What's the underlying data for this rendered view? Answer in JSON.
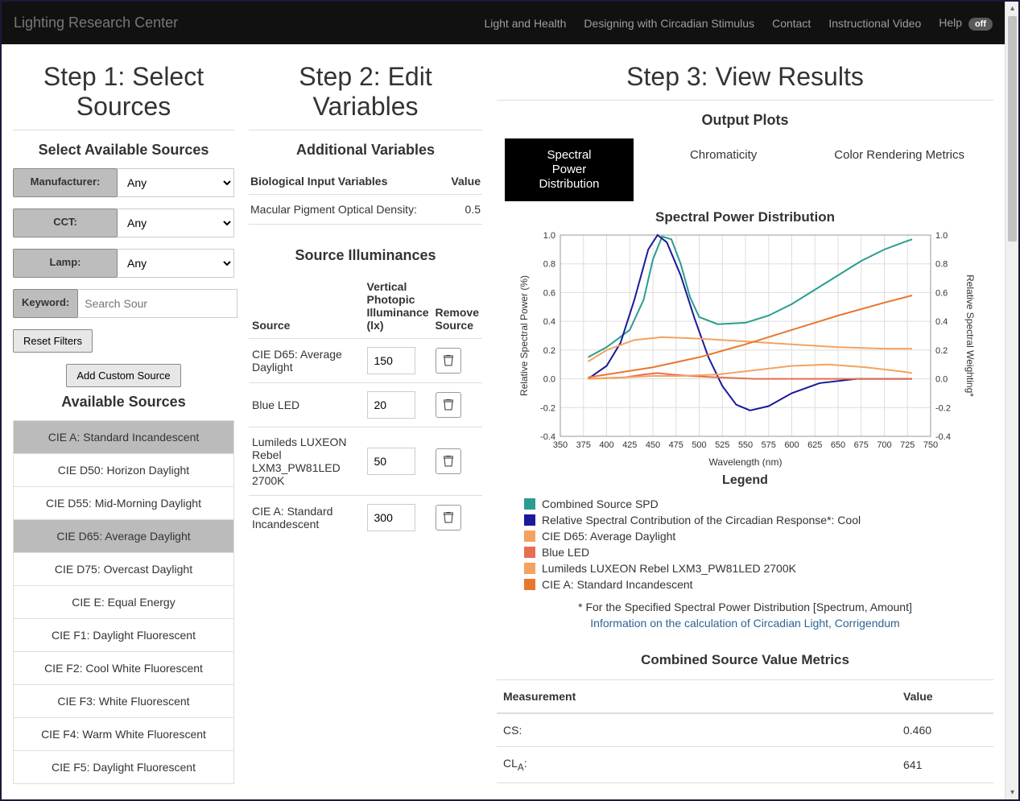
{
  "nav": {
    "brand": "Lighting Research Center",
    "links": [
      "Light and Health",
      "Designing with Circadian Stimulus",
      "Contact",
      "Instructional Video"
    ],
    "help_label": "Help",
    "help_badge": "off"
  },
  "step1": {
    "title": "Step 1: Select Sources",
    "subtitle": "Select Available Sources",
    "filters": {
      "manufacturer_label": "Manufacturer:",
      "cct_label": "CCT:",
      "lamp_label": "Lamp:",
      "keyword_label": "Keyword:",
      "any": "Any",
      "keyword_placeholder": "Search Sour"
    },
    "reset_btn": "Reset Filters",
    "add_custom_btn": "Add Custom Source",
    "available_title": "Available Sources",
    "sources": [
      {
        "label": "CIE A: Standard Incandescent",
        "selected": true
      },
      {
        "label": "CIE D50: Horizon Daylight",
        "selected": false
      },
      {
        "label": "CIE D55: Mid-Morning Daylight",
        "selected": false
      },
      {
        "label": "CIE D65: Average Daylight",
        "selected": true
      },
      {
        "label": "CIE D75: Overcast Daylight",
        "selected": false
      },
      {
        "label": "CIE E: Equal Energy",
        "selected": false
      },
      {
        "label": "CIE F1: Daylight Fluorescent",
        "selected": false
      },
      {
        "label": "CIE F2: Cool White Fluorescent",
        "selected": false
      },
      {
        "label": "CIE F3: White Fluorescent",
        "selected": false
      },
      {
        "label": "CIE F4: Warm White Fluorescent",
        "selected": false
      },
      {
        "label": "CIE F5: Daylight Fluorescent",
        "selected": false
      }
    ]
  },
  "step2": {
    "title": "Step 2: Edit Variables",
    "addl_title": "Additional Variables",
    "bio_header": "Biological Input Variables",
    "value_header": "Value",
    "bio_row_label": "Macular Pigment Optical Density:",
    "bio_row_value": "0.5",
    "illum_title": "Source Illuminances",
    "col_source": "Source",
    "col_vpi": "Vertical Photopic Illuminance (lx)",
    "col_remove": "Remove Source",
    "rows": [
      {
        "name": "CIE D65: Average Daylight",
        "lx": "150"
      },
      {
        "name": "Blue LED",
        "lx": "20"
      },
      {
        "name": "Lumileds LUXEON Rebel LXM3_PW81LED 2700K",
        "lx": "50"
      },
      {
        "name": "CIE A: Standard Incandescent",
        "lx": "300"
      }
    ]
  },
  "step3": {
    "title": "Step 3: View Results",
    "plots_title": "Output Plots",
    "tabs": [
      "Spectral Power Distribution",
      "Chromaticity",
      "Color Rendering Metrics"
    ],
    "active_tab": 0,
    "chart_title": "Spectral Power Distribution",
    "legend_title": "Legend",
    "legend": [
      {
        "color": "#2a9d8f",
        "label": "Combined Source SPD"
      },
      {
        "color": "#1a1a9a",
        "label": "Relative Spectral Contribution of the Circadian Response*: Cool"
      },
      {
        "color": "#f4a261",
        "label": "CIE D65: Average Daylight"
      },
      {
        "color": "#e76f51",
        "label": "Blue LED"
      },
      {
        "color": "#f4a261",
        "label": "Lumileds LUXEON Rebel LXM3_PW81LED 2700K"
      },
      {
        "color": "#e8772d",
        "label": "CIE A: Standard Incandescent"
      }
    ],
    "footnote": "* For the Specified Spectral Power Distribution [Spectrum, Amount]",
    "link_text": "Information on the calculation of Circadian Light, Corrigendum",
    "metrics_title": "Combined Source Value Metrics",
    "metrics_headers": [
      "Measurement",
      "Value"
    ],
    "metrics": [
      {
        "label": "CS:",
        "value": "0.460"
      },
      {
        "label_html": "CL<sub>A</sub>:",
        "value": "641"
      }
    ],
    "xlabel": "Wavelength (nm)",
    "ylabel_left": "Relative Spectral Power (%)",
    "ylabel_right": "Relative Spectral Weighting*"
  },
  "chart_data": {
    "type": "line",
    "title": "Spectral Power Distribution",
    "xlabel": "Wavelength (nm)",
    "ylabel_left": "Relative Spectral Power (%)",
    "ylabel_right": "Relative Spectral Weighting*",
    "xlim": [
      350,
      750
    ],
    "ylim": [
      -0.4,
      1.0
    ],
    "xticks": [
      350,
      375,
      400,
      425,
      450,
      475,
      500,
      525,
      550,
      575,
      600,
      625,
      650,
      675,
      700,
      725,
      750
    ],
    "yticks": [
      -0.4,
      -0.2,
      0,
      0.2,
      0.4,
      0.6,
      0.8,
      1.0
    ],
    "series": [
      {
        "name": "Combined Source SPD",
        "color": "#2a9d8f",
        "x": [
          380,
          400,
          425,
          440,
          450,
          460,
          470,
          480,
          490,
          500,
          520,
          550,
          575,
          600,
          625,
          650,
          675,
          700,
          725,
          730
        ],
        "y": [
          0.15,
          0.22,
          0.34,
          0.55,
          0.83,
          0.99,
          0.97,
          0.8,
          0.57,
          0.43,
          0.38,
          0.39,
          0.44,
          0.52,
          0.62,
          0.72,
          0.82,
          0.9,
          0.96,
          0.97
        ]
      },
      {
        "name": "Relative Spectral Contribution of the Circadian Response*: Cool",
        "color": "#1a1a9a",
        "x": [
          380,
          400,
          415,
          430,
          445,
          455,
          465,
          480,
          495,
          510,
          525,
          540,
          555,
          575,
          600,
          630,
          670,
          730
        ],
        "y": [
          0.0,
          0.09,
          0.25,
          0.55,
          0.9,
          1.0,
          0.95,
          0.72,
          0.42,
          0.15,
          -0.05,
          -0.18,
          -0.22,
          -0.19,
          -0.1,
          -0.03,
          0.0,
          0.0
        ]
      },
      {
        "name": "CIE D65: Average Daylight",
        "color": "#f4a261",
        "x": [
          380,
          400,
          430,
          460,
          500,
          550,
          600,
          650,
          700,
          730
        ],
        "y": [
          0.12,
          0.2,
          0.27,
          0.29,
          0.28,
          0.26,
          0.24,
          0.22,
          0.21,
          0.21
        ]
      },
      {
        "name": "Blue LED",
        "color": "#e76f51",
        "x": [
          380,
          420,
          440,
          455,
          470,
          490,
          520,
          560,
          600,
          730
        ],
        "y": [
          0.0,
          0.01,
          0.03,
          0.04,
          0.03,
          0.02,
          0.01,
          0.0,
          0.0,
          0.0
        ]
      },
      {
        "name": "Lumileds LUXEON Rebel LXM3_PW81LED 2700K",
        "color": "#f4a261",
        "x": [
          380,
          420,
          450,
          480,
          520,
          560,
          600,
          640,
          680,
          720,
          730
        ],
        "y": [
          0.0,
          0.01,
          0.02,
          0.02,
          0.03,
          0.06,
          0.09,
          0.1,
          0.08,
          0.05,
          0.04
        ]
      },
      {
        "name": "CIE A: Standard Incandescent",
        "color": "#e8772d",
        "x": [
          380,
          400,
          450,
          500,
          550,
          600,
          650,
          700,
          730
        ],
        "y": [
          0.01,
          0.03,
          0.08,
          0.15,
          0.24,
          0.34,
          0.44,
          0.53,
          0.58
        ]
      }
    ]
  }
}
